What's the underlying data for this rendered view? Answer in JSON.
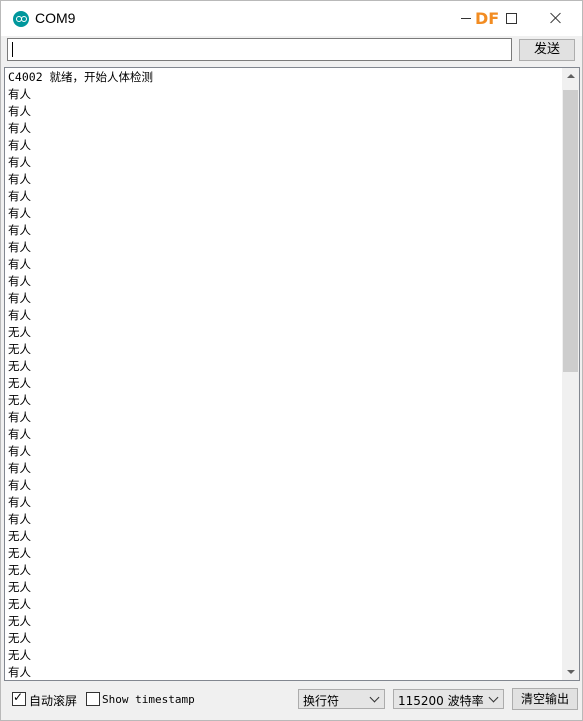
{
  "window": {
    "title": "COM9",
    "watermark": "DF"
  },
  "input_row": {
    "value": "",
    "send_label": "发送"
  },
  "output": {
    "lines": [
      "C4002 就绪，开始人体检测",
      "有人",
      "有人",
      "有人",
      "有人",
      "有人",
      "有人",
      "有人",
      "有人",
      "有人",
      "有人",
      "有人",
      "有人",
      "有人",
      "有人",
      "无人",
      "无人",
      "无人",
      "无人",
      "无人",
      "有人",
      "有人",
      "有人",
      "有人",
      "有人",
      "有人",
      "有人",
      "无人",
      "无人",
      "无人",
      "无人",
      "无人",
      "无人",
      "无人",
      "无人",
      "有人"
    ]
  },
  "bottom_bar": {
    "autoscroll_label": "自动滚屏",
    "autoscroll_checked": true,
    "timestamp_label": "Show timestamp",
    "timestamp_checked": false,
    "line_ending": "换行符",
    "baud_rate": "115200 波特率",
    "clear_label": "清空输出"
  },
  "colors": {
    "app_icon": "#00979c",
    "watermark": "#f28c22"
  }
}
